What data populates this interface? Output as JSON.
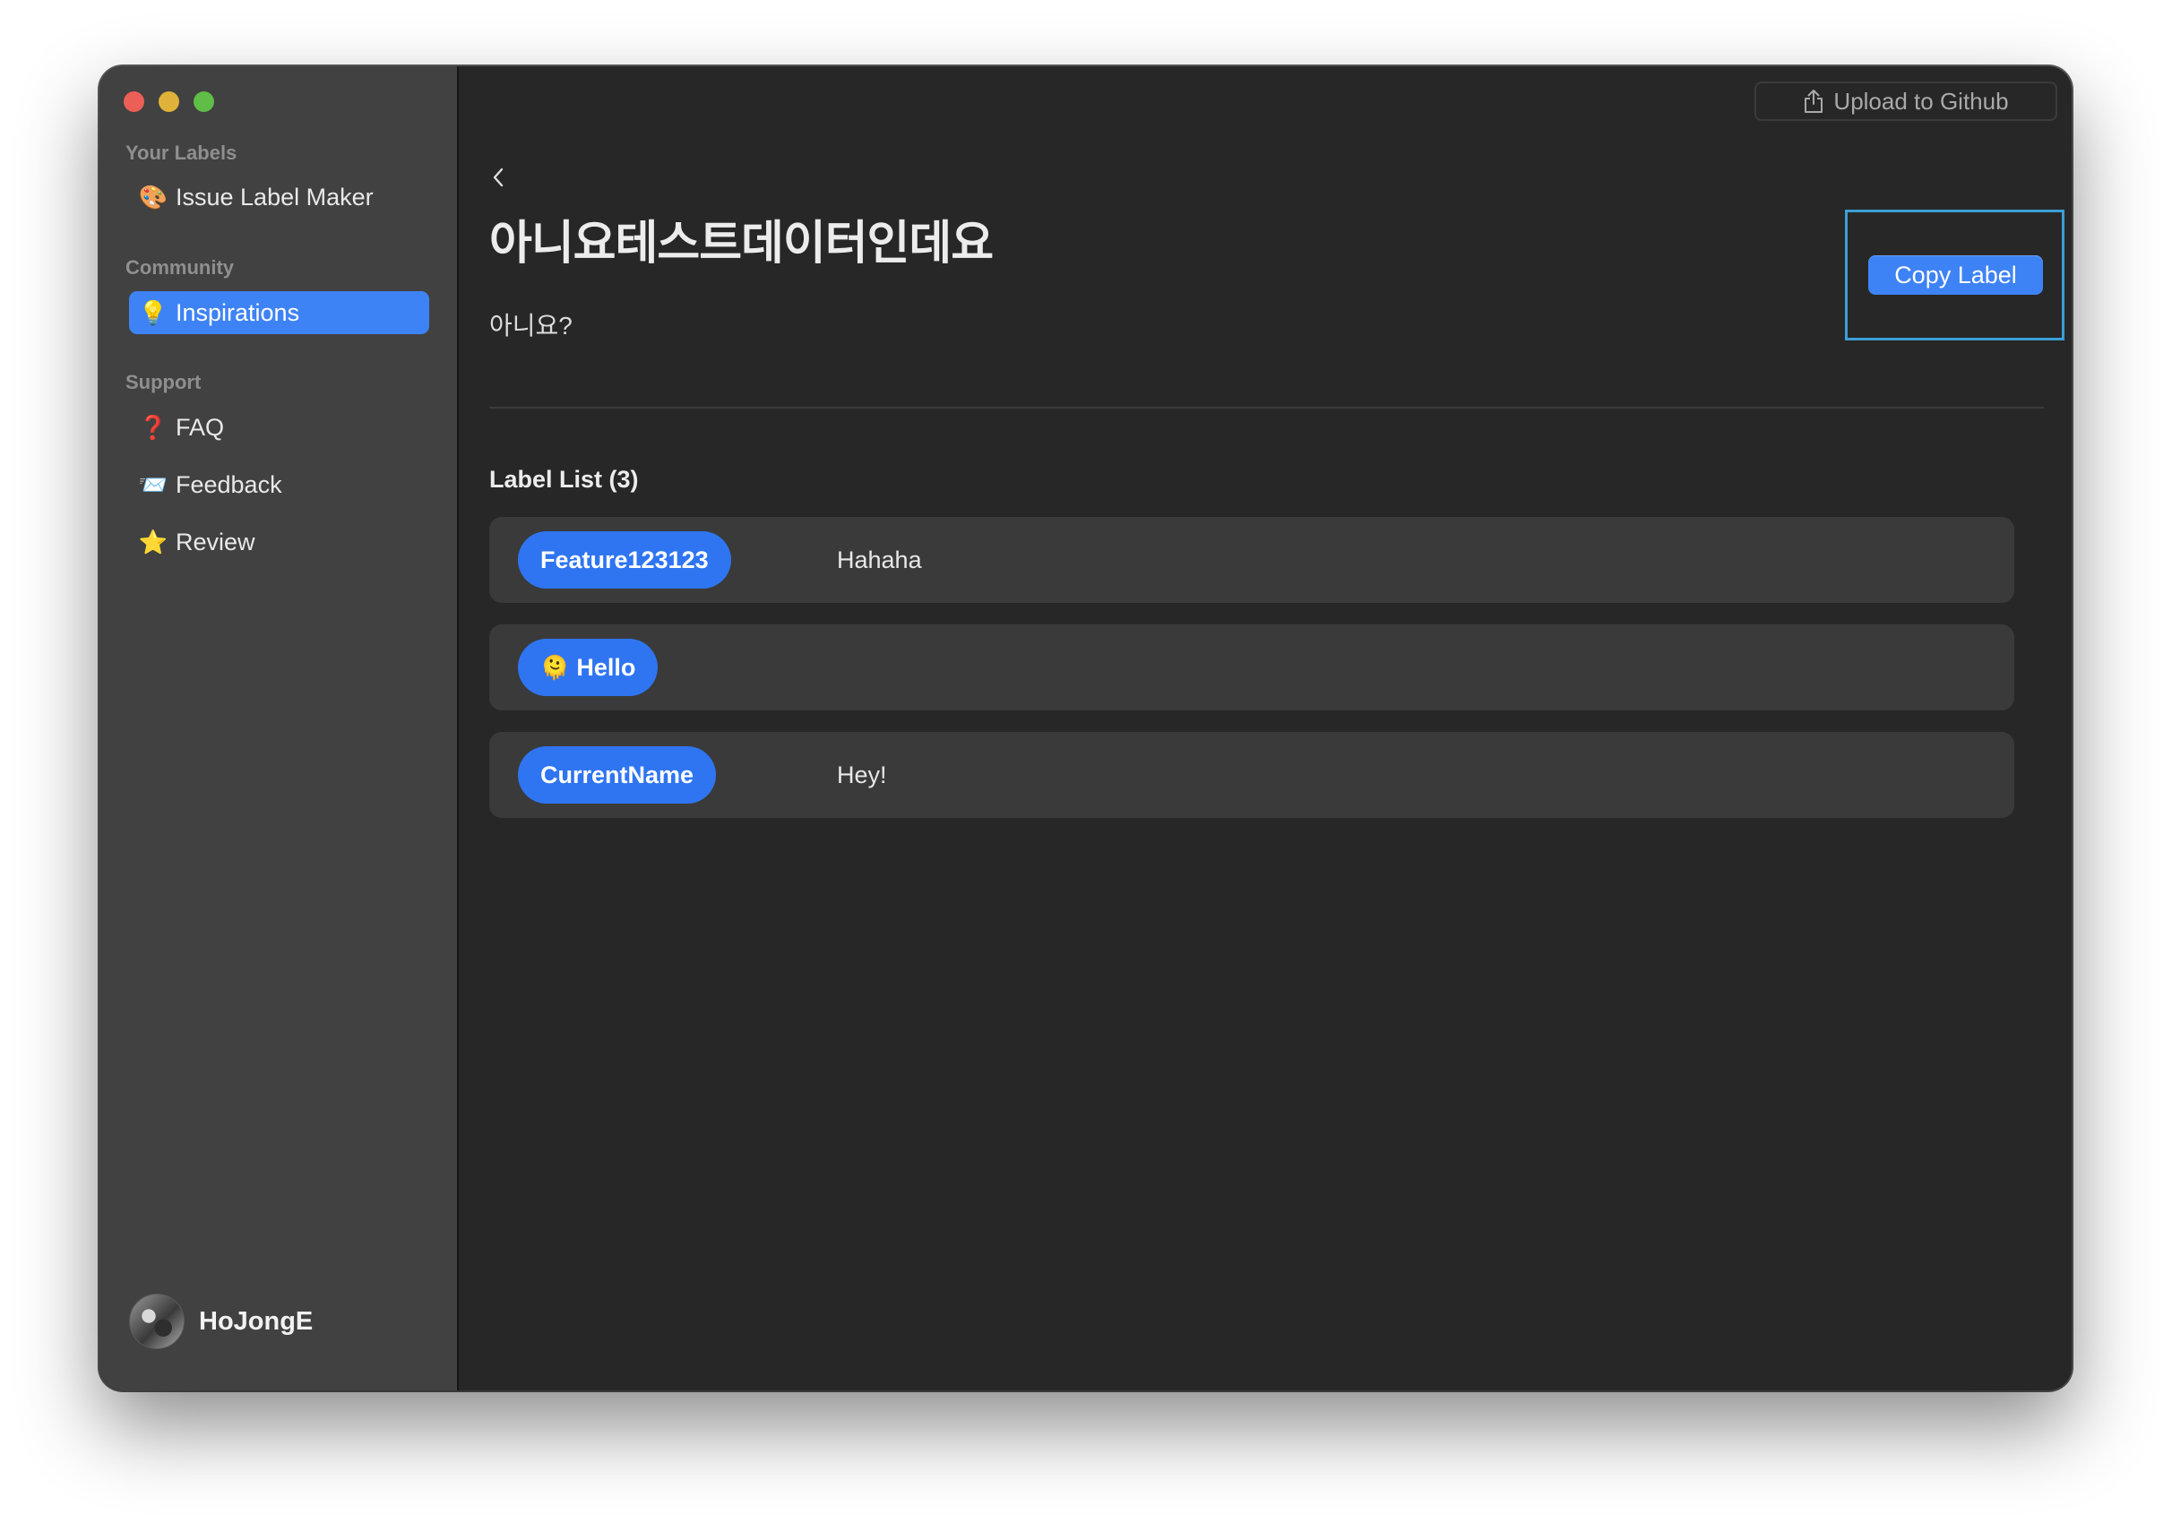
{
  "window": {
    "traffic_lights": [
      "close",
      "minimize",
      "zoom"
    ]
  },
  "sidebar": {
    "sections": [
      {
        "title": "Your Labels",
        "items": [
          {
            "icon": "palette-icon",
            "glyph": "🎨",
            "label": "Issue Label Maker",
            "active": false
          }
        ]
      },
      {
        "title": "Community",
        "items": [
          {
            "icon": "lightbulb-icon",
            "glyph": "💡",
            "label": "Inspirations",
            "active": true
          }
        ]
      },
      {
        "title": "Support",
        "items": [
          {
            "icon": "question-mark-icon",
            "glyph": "❓",
            "label": "FAQ",
            "active": false
          },
          {
            "icon": "envelope-icon",
            "glyph": "📨",
            "label": "Feedback",
            "active": false
          },
          {
            "icon": "star-icon",
            "glyph": "⭐",
            "label": "Review",
            "active": false
          }
        ]
      }
    ],
    "user": {
      "name": "HoJongE"
    }
  },
  "toolbar": {
    "upload_label": "Upload to Github",
    "upload_icon": "share-icon"
  },
  "main": {
    "back_icon": "chevron-left-icon",
    "title": "아니요테스트데이터인데요",
    "description": "아니요?",
    "copy_label": "Copy Label",
    "label_list_title": "Label List (3)",
    "labels": [
      {
        "emoji": "",
        "name": "Feature123123",
        "description": "Hahaha"
      },
      {
        "emoji": "🫠",
        "name": "Hello",
        "description": ""
      },
      {
        "emoji": "",
        "name": "CurrentName",
        "description": "Hey!"
      }
    ]
  },
  "colors": {
    "accent": "#3e83f5",
    "pill": "#2f75f2",
    "sidebar_bg": "#414141",
    "content_bg": "#272727",
    "row_bg": "#3a3a3a",
    "highlight_frame": "#3d9ed8"
  }
}
